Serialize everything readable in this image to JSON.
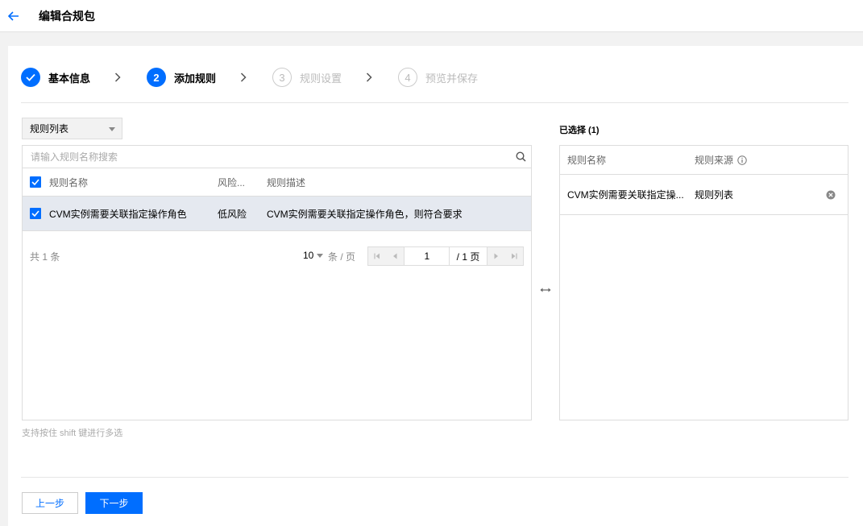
{
  "header": {
    "title": "编辑合规包"
  },
  "steps": [
    {
      "number": "1",
      "label": "基本信息",
      "state": "done"
    },
    {
      "number": "2",
      "label": "添加规则",
      "state": "current"
    },
    {
      "number": "3",
      "label": "规则设置",
      "state": "todo"
    },
    {
      "number": "4",
      "label": "预览并保存",
      "state": "todo"
    }
  ],
  "source_select": {
    "value": "规则列表"
  },
  "search": {
    "placeholder": "请输入规则名称搜索"
  },
  "left_table": {
    "columns": [
      "规则名称",
      "风险...",
      "规则描述"
    ],
    "rows": [
      {
        "name": "CVM实例需要关联指定操作角色",
        "risk": "低风险",
        "description": "CVM实例需要关联指定操作角色，则符合要求",
        "checked": true
      }
    ],
    "header_checked": true
  },
  "pagination": {
    "total": "共 1 条",
    "page_size": "10",
    "page_size_unit": "条 / 页",
    "current_page": "1",
    "total_pages": "/ 1 页"
  },
  "hint": "支持按住 shift 键进行多选",
  "selected": {
    "title": "已选择 (1)",
    "columns": [
      "规则名称",
      "规则来源"
    ],
    "rows": [
      {
        "name": "CVM实例需要关联指定操...",
        "source": "规则列表"
      }
    ]
  },
  "buttons": {
    "prev": "上一步",
    "next": "下一步"
  },
  "colors": {
    "primary": "#006eff",
    "row_selected": "#e5e9f0",
    "border": "#dddddd",
    "muted": "#888888"
  }
}
